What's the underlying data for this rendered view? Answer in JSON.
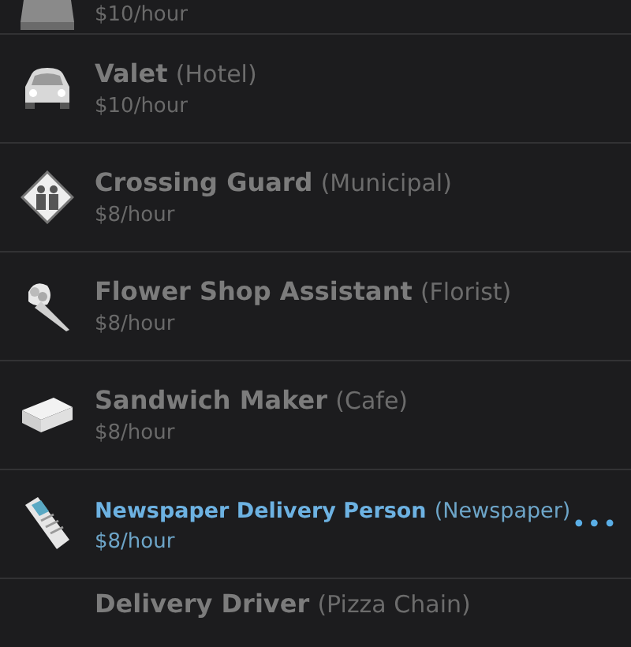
{
  "jobs": [
    {
      "kind": "tray",
      "wage": "$10/hour",
      "selected": false
    },
    {
      "kind": "car",
      "title": "Valet",
      "employer": "(Hotel)",
      "wage": "$10/hour",
      "selected": false
    },
    {
      "kind": "sign",
      "title": "Crossing Guard",
      "employer": "(Municipal)",
      "wage": "$8/hour",
      "selected": false
    },
    {
      "kind": "flowers",
      "title": "Flower Shop Assistant",
      "employer": "(Florist)",
      "wage": "$8/hour",
      "selected": false
    },
    {
      "kind": "sandwich",
      "title": "Sandwich Maker",
      "employer": "(Cafe)",
      "wage": "$8/hour",
      "selected": false
    },
    {
      "kind": "newspaper",
      "title": "Newspaper Delivery Person",
      "employer": "(Newspaper)",
      "wage": "$8/hour",
      "selected": true,
      "actions": "•••"
    },
    {
      "kind": "hidden",
      "title": "Delivery Driver",
      "employer": "(Pizza Chain)",
      "selected": false
    }
  ]
}
